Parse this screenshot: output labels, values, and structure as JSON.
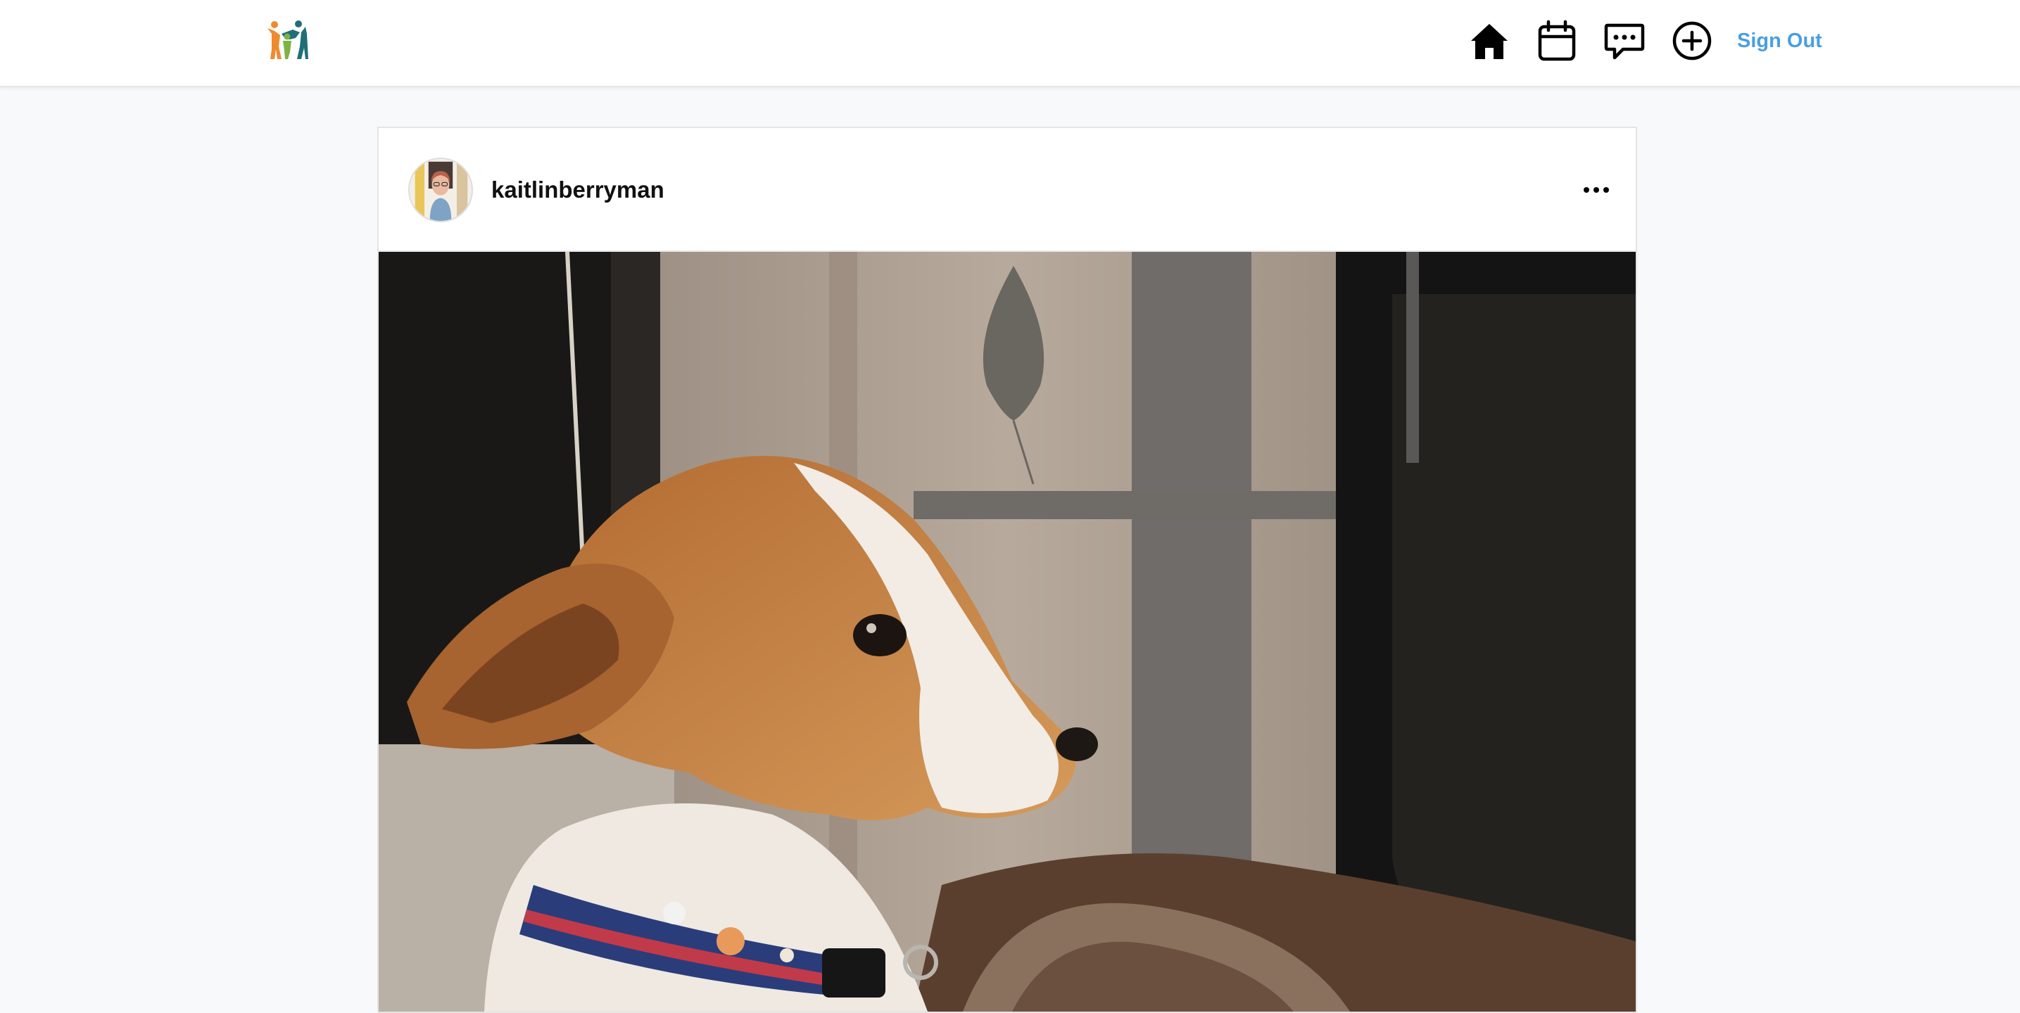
{
  "app": {
    "logo_icon": "people-family-logo",
    "colors": {
      "accent": "#4a9fe0",
      "logo_orange": "#ef8a2e",
      "logo_teal": "#1f6e78",
      "logo_green": "#7db343"
    }
  },
  "nav": {
    "items": [
      {
        "icon": "home-icon"
      },
      {
        "icon": "calendar-icon"
      },
      {
        "icon": "chat-icon"
      },
      {
        "icon": "add-circle-icon"
      }
    ],
    "signout_label": "Sign Out"
  },
  "post": {
    "username": "kaitlinberryman",
    "avatar_icon": "user-avatar",
    "more_icon": "more-options-icon",
    "image_icon": "dog-photo"
  }
}
